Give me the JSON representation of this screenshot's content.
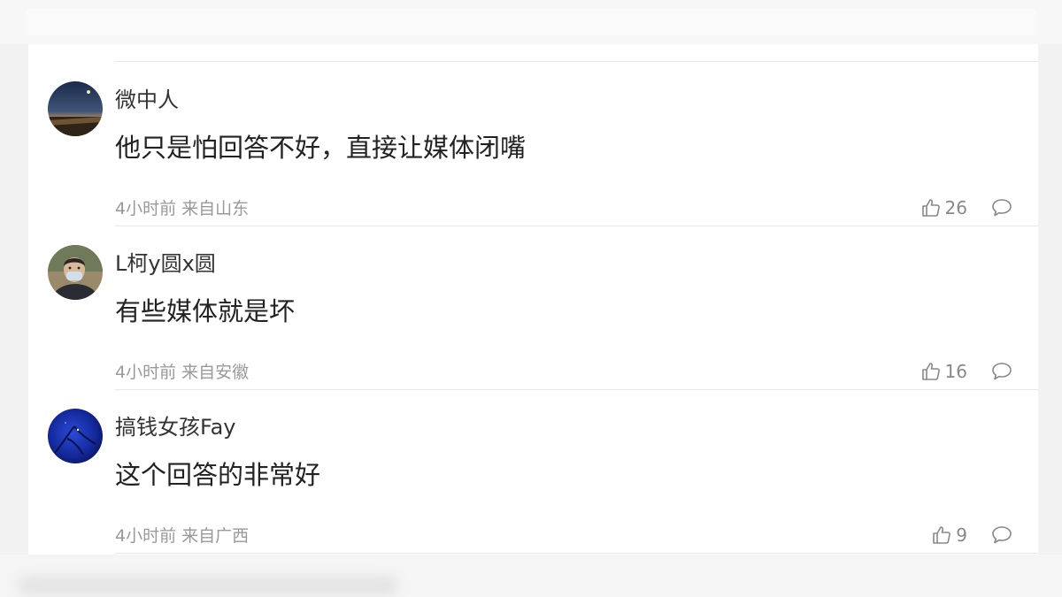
{
  "comments": [
    {
      "username": "微中人",
      "text": "他只是怕回答不好，直接让媒体闭嘴",
      "time": "4小时前",
      "location": "来自山东",
      "likes": "26",
      "avatar": "night-landscape-avatar"
    },
    {
      "username": "L柯y圆x圆",
      "text": "有些媒体就是坏",
      "time": "4小时前",
      "location": "来自安徽",
      "likes": "16",
      "avatar": "masked-person-avatar"
    },
    {
      "username": "搞钱女孩Fay",
      "text": "这个回答的非常好",
      "time": "4小时前",
      "location": "来自广西",
      "likes": "9",
      "avatar": "blue-night-avatar"
    }
  ],
  "icons": {
    "like": "thumbs-up-icon",
    "reply": "speech-bubble-icon"
  },
  "colors": {
    "username": "#333333",
    "content": "#222222",
    "meta": "#999999",
    "divider": "#e8e8e8"
  }
}
